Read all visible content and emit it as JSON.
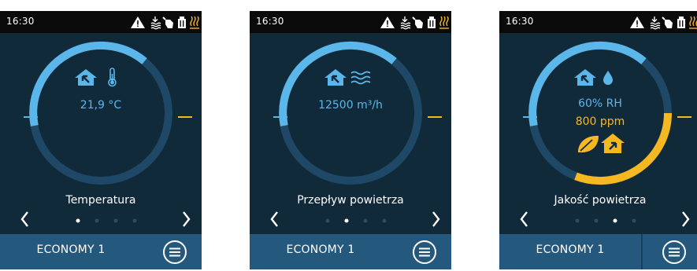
{
  "colors": {
    "accent_blue": "#5bb6ea",
    "accent_amber": "#f5b821",
    "ring_track": "#1f4766",
    "screen_bg": "#112a3a",
    "bottom_bar": "#25587d",
    "status_bar": "#0a0a0a"
  },
  "screens": [
    {
      "time": "16:30",
      "status_icons": [
        "warning-icon",
        "heat-recovery-icon",
        "hand-override-icon",
        "calendar-icon",
        "heating-icon"
      ],
      "gauge_icons": [
        "home-in-icon",
        "thermometer-icon"
      ],
      "values": [
        "21,9 °C"
      ],
      "title": "Temperatura",
      "active_page": 0,
      "page_count": 4,
      "mode": "ECONOMY 1",
      "menu_icon": "menu-icon",
      "gauge_level_pct": 35
    },
    {
      "time": "16:30",
      "status_icons": [
        "warning-icon",
        "heat-recovery-icon",
        "hand-override-icon",
        "calendar-icon",
        "heating-icon"
      ],
      "gauge_icons": [
        "home-in-icon",
        "airflow-icon"
      ],
      "values": [
        "12500 m³/h"
      ],
      "title": "Przepływ powietrza",
      "active_page": 1,
      "page_count": 4,
      "mode": "ECONOMY 1",
      "menu_icon": "menu-icon",
      "gauge_level_pct": 35
    },
    {
      "time": "16:30",
      "status_icons": [
        "warning-icon",
        "heat-recovery-icon",
        "hand-override-icon",
        "calendar-icon",
        "heating-icon"
      ],
      "gauge_icons": [
        "home-in-icon",
        "humidity-drop-icon"
      ],
      "values": [
        "60% RH",
        "800 ppm"
      ],
      "title": "Jakość powietrza",
      "active_page": 2,
      "page_count": 4,
      "mode": "ECONOMY 1",
      "menu_icon": "menu-icon",
      "bottom_icons": [
        "leaf-icon",
        "home-out-icon"
      ],
      "gauge_level_pct": 35,
      "secondary_gauge_level_pct": 32
    }
  ]
}
